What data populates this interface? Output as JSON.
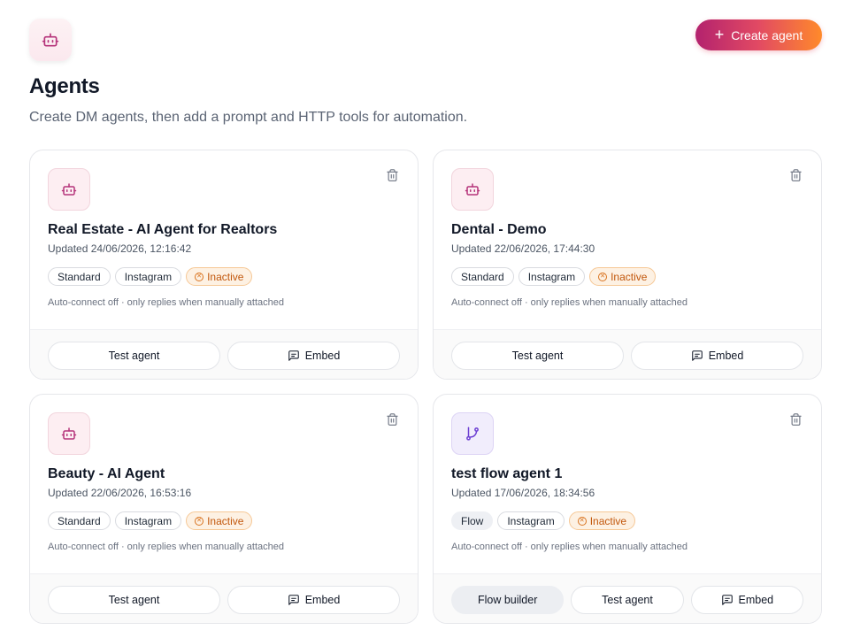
{
  "header": {
    "icon": "robot-icon",
    "title": "Agents",
    "subtitle": "Create DM agents, then add a prompt and HTTP tools for automation.",
    "create_button": "Create agent"
  },
  "colors": {
    "accent_gradient": [
      "#b3226e",
      "#e24a63",
      "#ff8a2a"
    ],
    "inactive_text": "#c2570c",
    "inactive_bg": "#fdf1e3",
    "robot_icon": "#b5337a",
    "flow_icon": "#6d3fd3"
  },
  "cards": [
    {
      "icon": "robot-icon",
      "name": "Real Estate - AI Agent for Realtors",
      "updated": "Updated 24/06/2026, 12:16:42",
      "tags": [
        "Standard",
        "Instagram"
      ],
      "status": "Inactive",
      "hint": "Auto-connect off · only replies when manually attached",
      "buttons": {
        "test": "Test agent",
        "embed": "Embed"
      }
    },
    {
      "icon": "robot-icon",
      "name": "Dental - Demo",
      "updated": "Updated 22/06/2026, 17:44:30",
      "tags": [
        "Standard",
        "Instagram"
      ],
      "status": "Inactive",
      "hint": "Auto-connect off · only replies when manually attached",
      "buttons": {
        "test": "Test agent",
        "embed": "Embed"
      }
    },
    {
      "icon": "robot-icon",
      "name": "Beauty - AI Agent",
      "updated": "Updated 22/06/2026, 16:53:16",
      "tags": [
        "Standard",
        "Instagram"
      ],
      "status": "Inactive",
      "hint": "Auto-connect off · only replies when manually attached",
      "buttons": {
        "test": "Test agent",
        "embed": "Embed"
      }
    },
    {
      "icon": "git-branch-icon",
      "name": "test flow agent 1",
      "updated": "Updated 17/06/2026, 18:34:56",
      "tags": [
        "Flow",
        "Instagram"
      ],
      "status": "Inactive",
      "hint": "Auto-connect off · only replies when manually attached",
      "buttons": {
        "flow_builder": "Flow builder",
        "test": "Test agent",
        "embed": "Embed"
      }
    }
  ]
}
